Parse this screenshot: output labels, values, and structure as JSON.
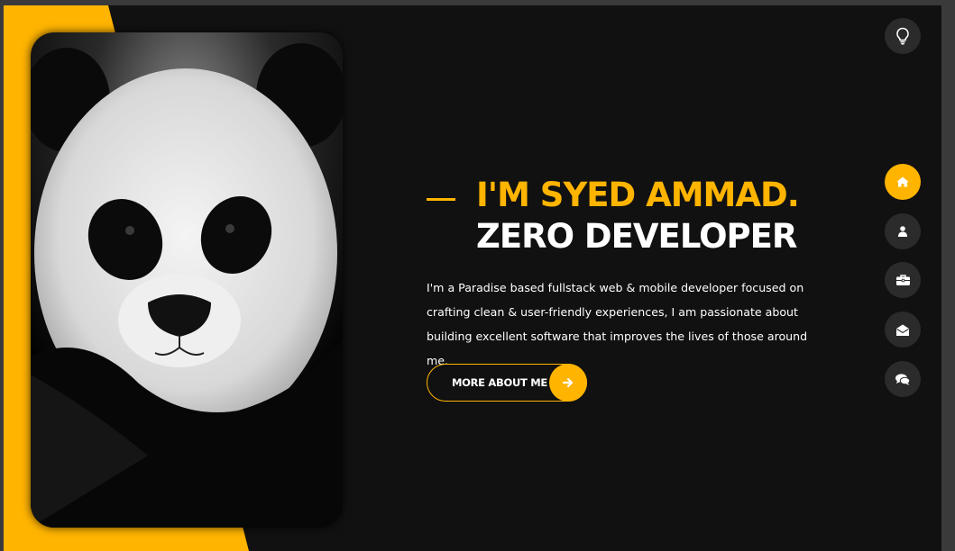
{
  "hero": {
    "title_line1": "I'M SYED AMMAD.",
    "title_line2": "ZERO DEVELOPER",
    "description": "I'm a Paradise based fullstack web & mobile developer focused on crafting clean & user-friendly experiences, I am passionate about building excellent software that improves the lives of those around me.",
    "button_label": "MORE ABOUT ME",
    "button_icon": "arrow-right-icon"
  },
  "photo": {
    "subject": "panda"
  },
  "theme_toggle": {
    "icon": "lightbulb-icon"
  },
  "nav": [
    {
      "icon": "home-icon",
      "active": true
    },
    {
      "icon": "user-icon",
      "active": false
    },
    {
      "icon": "briefcase-icon",
      "active": false
    },
    {
      "icon": "envelope-open-icon",
      "active": false
    },
    {
      "icon": "comments-icon",
      "active": false
    }
  ],
  "colors": {
    "accent": "#ffb400",
    "background": "#111111",
    "nav_circle": "#2b2b2b",
    "text": "#ffffff"
  }
}
